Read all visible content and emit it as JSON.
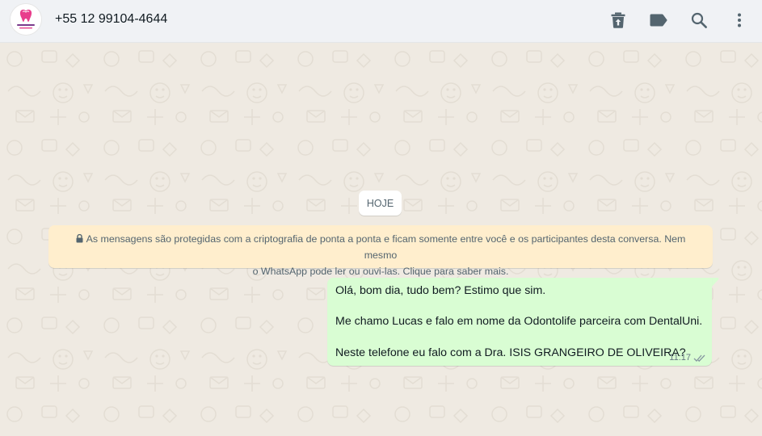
{
  "header": {
    "contact_name": "+55 12 99104-4644",
    "avatar_logo_text": "Dental Uni"
  },
  "icons": {
    "archive": "archive-icon",
    "label": "label-icon",
    "search": "search-icon",
    "menu": "more-vertical-icon",
    "lock": "lock-icon",
    "read_receipt": "double-check-icon"
  },
  "chat": {
    "date_label": "HOJE",
    "encryption_notice": {
      "line1": "As mensagens são protegidas com a criptografia de ponta a ponta e ficam somente entre você e os participantes desta conversa. Nem mesmo",
      "line2": "o WhatsApp pode ler ou ouvi-las. Clique para saber mais."
    },
    "messages": [
      {
        "direction": "outgoing",
        "lines": [
          "Olá, bom dia, tudo bem? Estimo que sim.",
          "Me chamo Lucas e falo em nome da Odontolife parceira com DentalUni.",
          "Neste telefone eu falo com a Dra. ISIS GRANGEIRO DE OLIVEIRA?"
        ],
        "time": "11:17",
        "status": "read"
      }
    ]
  },
  "colors": {
    "header_bg": "#f0f2f5",
    "chat_bg": "#efeae2",
    "outgoing_bubble": "#d9fdd3",
    "notice_bg": "#ffeecd",
    "icon": "#54656f",
    "read_tick": "#8696a0"
  }
}
